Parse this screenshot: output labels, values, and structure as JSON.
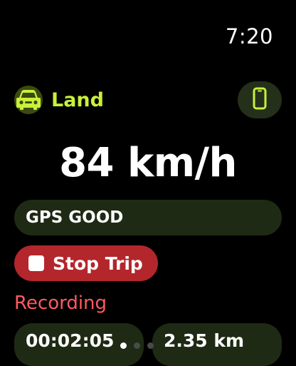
{
  "status_bar": {
    "time": "7:20"
  },
  "mode": {
    "label": "Land",
    "icon": "car-icon",
    "accent_color": "#c9f03a"
  },
  "phone_button": {
    "icon": "phone-icon"
  },
  "speed": {
    "value": "84 km/h"
  },
  "gps": {
    "status": "GPS GOOD"
  },
  "trip": {
    "stop_label": "Stop Trip",
    "stop_color": "#b3262b",
    "recording_label": "Recording",
    "recording_color": "#ff5a5f"
  },
  "stats": {
    "elapsed": "00:02:05",
    "distance": "2.35 km"
  },
  "pagination": {
    "total": 3,
    "active": 1
  }
}
